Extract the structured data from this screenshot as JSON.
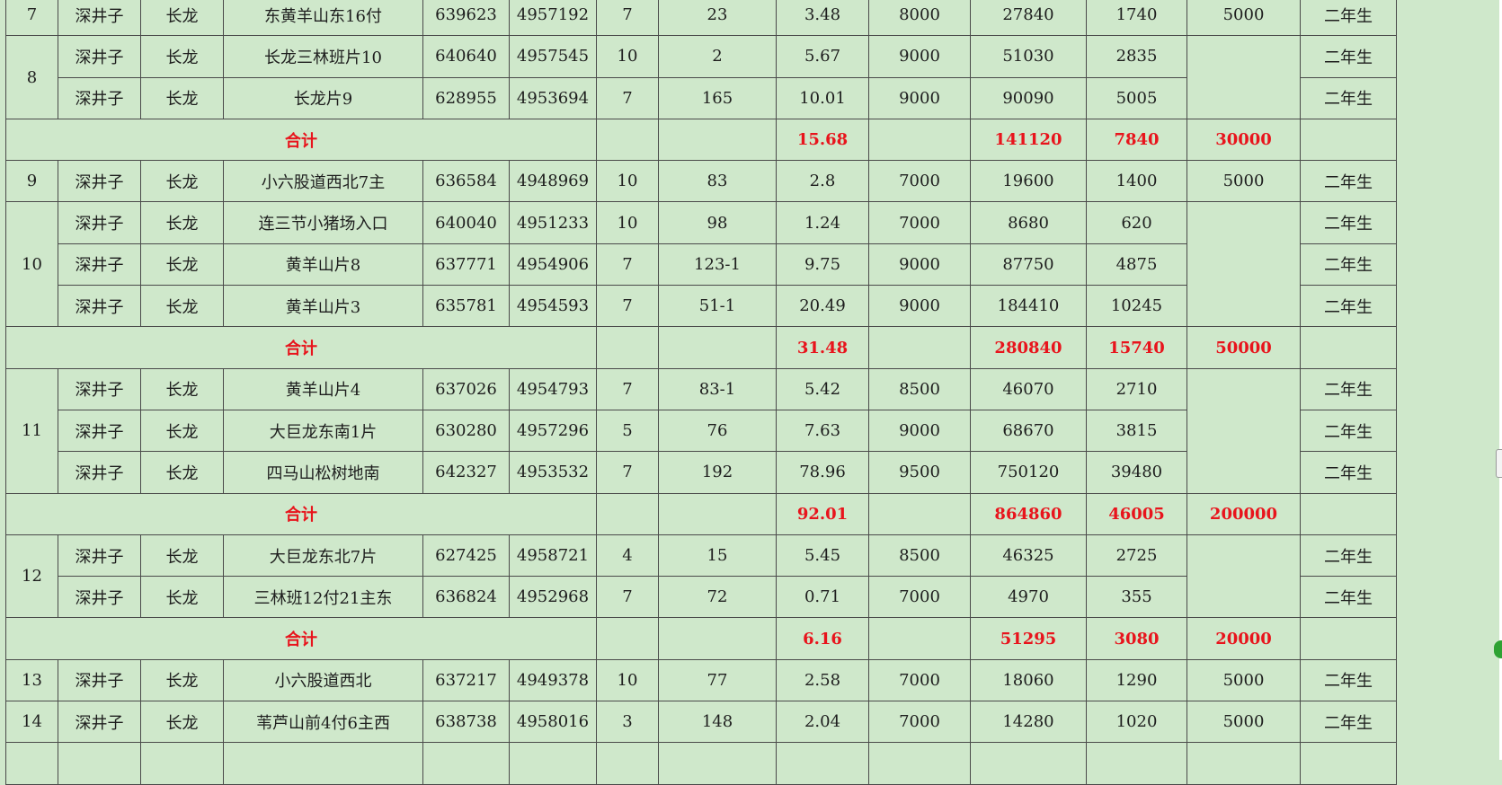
{
  "spreadsheet": {
    "subtotal_label": "合计",
    "rows": [
      {
        "type": "data",
        "no": "7",
        "township": "深井子",
        "village": "长龙",
        "plot": "东黄羊山东16付",
        "x": "639623",
        "y": "4957192",
        "lin_ban": "7",
        "xiao_ban": "23",
        "area": "3.48",
        "price": "8000",
        "amount": "27840",
        "fee": "1740",
        "deposit": "5000",
        "remark": "二年生"
      },
      {
        "type": "data",
        "no": "8",
        "township": "深井子",
        "village": "长龙",
        "plot": "长龙三林班片10",
        "x": "640640",
        "y": "4957545",
        "lin_ban": "10",
        "xiao_ban": "2",
        "area": "5.67",
        "price": "9000",
        "amount": "51030",
        "fee": "2835",
        "remark": "二年生"
      },
      {
        "type": "data",
        "township": "深井子",
        "village": "长龙",
        "plot": "长龙片9",
        "x": "628955",
        "y": "4953694",
        "lin_ban": "7",
        "xiao_ban": "165",
        "area": "10.01",
        "price": "9000",
        "amount": "90090",
        "fee": "5005",
        "remark": "二年生"
      },
      {
        "type": "total",
        "area": "15.68",
        "amount": "141120",
        "fee": "7840",
        "deposit": "30000"
      },
      {
        "type": "data",
        "no": "9",
        "township": "深井子",
        "village": "长龙",
        "plot": "小六股道西北7主",
        "x": "636584",
        "y": "4948969",
        "lin_ban": "10",
        "xiao_ban": "83",
        "area": "2.8",
        "price": "7000",
        "amount": "19600",
        "fee": "1400",
        "deposit": "5000",
        "remark": "二年生"
      },
      {
        "type": "data",
        "no": "10",
        "township": "深井子",
        "village": "长龙",
        "plot": "连三节小猪场入口",
        "x": "640040",
        "y": "4951233",
        "lin_ban": "10",
        "xiao_ban": "98",
        "area": "1.24",
        "price": "7000",
        "amount": "8680",
        "fee": "620",
        "remark": "二年生"
      },
      {
        "type": "data",
        "township": "深井子",
        "village": "长龙",
        "plot": "黄羊山片8",
        "x": "637771",
        "y": "4954906",
        "lin_ban": "7",
        "xiao_ban": "123-1",
        "area": "9.75",
        "price": "9000",
        "amount": "87750",
        "fee": "4875",
        "remark": "二年生"
      },
      {
        "type": "data",
        "township": "深井子",
        "village": "长龙",
        "plot": "黄羊山片3",
        "x": "635781",
        "y": "4954593",
        "lin_ban": "7",
        "xiao_ban": "51-1",
        "area": "20.49",
        "price": "9000",
        "amount": "184410",
        "fee": "10245",
        "remark": "二年生"
      },
      {
        "type": "total",
        "area": "31.48",
        "amount": "280840",
        "fee": "15740",
        "deposit": "50000"
      },
      {
        "type": "data",
        "no": "11",
        "township": "深井子",
        "village": "长龙",
        "plot": "黄羊山片4",
        "x": "637026",
        "y": "4954793",
        "lin_ban": "7",
        "xiao_ban": "83-1",
        "area": "5.42",
        "price": "8500",
        "amount": "46070",
        "fee": "2710",
        "remark": "二年生"
      },
      {
        "type": "data",
        "township": "深井子",
        "village": "长龙",
        "plot": "大巨龙东南1片",
        "x": "630280",
        "y": "4957296",
        "lin_ban": "5",
        "xiao_ban": "76",
        "area": "7.63",
        "price": "9000",
        "amount": "68670",
        "fee": "3815",
        "remark": "二年生"
      },
      {
        "type": "data",
        "township": "深井子",
        "village": "长龙",
        "plot": "四马山松树地南",
        "x": "642327",
        "y": "4953532",
        "lin_ban": "7",
        "xiao_ban": "192",
        "area": "78.96",
        "price": "9500",
        "amount": "750120",
        "fee": "39480",
        "remark": "二年生"
      },
      {
        "type": "total",
        "area": "92.01",
        "amount": "864860",
        "fee": "46005",
        "deposit": "200000"
      },
      {
        "type": "data",
        "no": "12",
        "township": "深井子",
        "village": "长龙",
        "plot": "大巨龙东北7片",
        "x": "627425",
        "y": "4958721",
        "lin_ban": "4",
        "xiao_ban": "15",
        "area": "5.45",
        "price": "8500",
        "amount": "46325",
        "fee": "2725",
        "remark": "二年生"
      },
      {
        "type": "data",
        "township": "深井子",
        "village": "长龙",
        "plot": "三林班12付21主东",
        "x": "636824",
        "y": "4952968",
        "lin_ban": "7",
        "xiao_ban": "72",
        "area": "0.71",
        "price": "7000",
        "amount": "4970",
        "fee": "355",
        "remark": "二年生"
      },
      {
        "type": "total",
        "area": "6.16",
        "amount": "51295",
        "fee": "3080",
        "deposit": "20000"
      },
      {
        "type": "data",
        "no": "13",
        "township": "深井子",
        "village": "长龙",
        "plot": "小六股道西北",
        "x": "637217",
        "y": "4949378",
        "lin_ban": "10",
        "xiao_ban": "77",
        "area": "2.58",
        "price": "7000",
        "amount": "18060",
        "fee": "1290",
        "deposit": "5000",
        "remark": "二年生"
      },
      {
        "type": "data",
        "no": "14",
        "township": "深井子",
        "village": "长龙",
        "plot": "苇芦山前4付6主西",
        "x": "638738",
        "y": "4958016",
        "lin_ban": "3",
        "xiao_ban": "148",
        "area": "2.04",
        "price": "7000",
        "amount": "14280",
        "fee": "1020",
        "deposit": "5000",
        "remark": "二年生"
      },
      {
        "type": "data",
        "township": "",
        "village": "",
        "plot": "",
        "x": "",
        "y": "",
        "lin_ban": "",
        "xiao_ban": "",
        "area": "",
        "price": "",
        "amount": "",
        "fee": "",
        "deposit": "",
        "remark": ""
      }
    ]
  }
}
